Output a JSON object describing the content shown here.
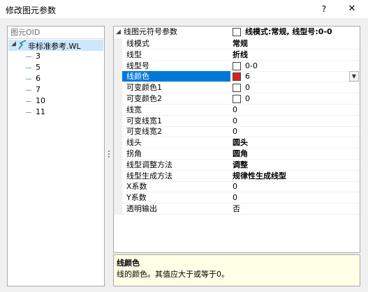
{
  "window": {
    "title": "修改图元参数",
    "help_label": "?",
    "close_label": "✕"
  },
  "tree": {
    "header": "图元OID",
    "root": {
      "expand_icon": "chevron-down",
      "icon": "line-style-icon",
      "label": "非标准参考.WL"
    },
    "children": [
      "3",
      "5",
      "6",
      "7",
      "10",
      "11"
    ]
  },
  "grid": {
    "category": {
      "label": "线图元符号参数",
      "value": "线模式:常规, 线型号:0-0"
    },
    "properties": [
      {
        "name": "线模式",
        "value": "常规"
      },
      {
        "name": "线型",
        "value": "折线"
      },
      {
        "name": "线型号",
        "value": "0-0"
      },
      {
        "name": "线颜色",
        "value": "6"
      },
      {
        "name": "可变颜色1",
        "value": "0"
      },
      {
        "name": "可变颜色2",
        "value": "0"
      },
      {
        "name": "线宽",
        "value": "0"
      },
      {
        "name": "可变线宽1",
        "value": "0"
      },
      {
        "name": "可变线宽2",
        "value": "0"
      },
      {
        "name": "线头",
        "value": "圆头"
      },
      {
        "name": "拐角",
        "value": "圆角"
      },
      {
        "name": "线型调整方法",
        "value": "调整"
      },
      {
        "name": "线型生成方法",
        "value": "规律性生成线型"
      },
      {
        "name": "X系数",
        "value": "0"
      },
      {
        "name": "Y系数",
        "value": "0"
      },
      {
        "name": "透明输出",
        "value": "否"
      }
    ],
    "selected_color": "#e02020"
  },
  "description": {
    "title": "线颜色",
    "text": "线的颜色。其值应大于或等于0。"
  }
}
